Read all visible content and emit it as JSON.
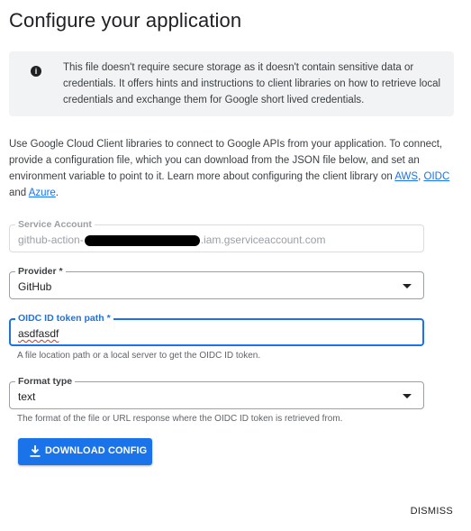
{
  "title": "Configure your application",
  "info": {
    "icon": "info-icon",
    "text": "This file doesn't require secure storage as it doesn't contain sensitive data or credentials. It offers hints and instructions to client libraries on how to retrieve local credentials and exchange them for Google short lived credentials."
  },
  "description": {
    "text": "Use Google Cloud Client libraries to connect to Google APIs from your application. To connect, provide a configuration file, which you can download from the JSON file below, and set an environment variable to point to it. Learn more about configuring the client library on",
    "link_aws": "AWS",
    "sep1": ",",
    "link_oidc": "OIDC",
    "and": "and",
    "link_azure": "Azure",
    "end": "."
  },
  "service_account": {
    "label": "Service Account",
    "value_prefix": "github-action-",
    "value_suffix": ".iam.gserviceaccount.com"
  },
  "provider": {
    "label": "Provider *",
    "value": "GitHub"
  },
  "oidc_path": {
    "label": "OIDC ID token path *",
    "value": "asdfasdf",
    "hint": "A file location path or a local server to get the OIDC ID token."
  },
  "format_type": {
    "label": "Format type",
    "value": "text",
    "hint": "The format of the file or URL response where the OIDC ID token is retrieved from."
  },
  "download_button": {
    "label": "DOWNLOAD CONFIG",
    "icon": "download-icon"
  },
  "dismiss_label": "DISMISS",
  "colors": {
    "accent": "#1a73e8",
    "info_background": "#f1f3f4",
    "text": "#202124"
  }
}
